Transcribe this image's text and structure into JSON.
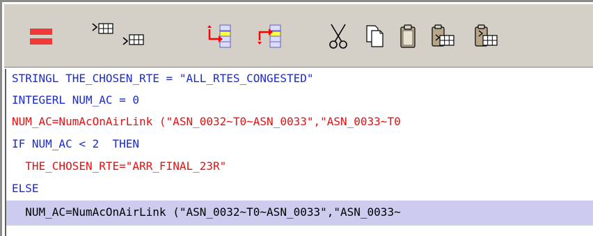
{
  "toolbar": {
    "buttons": [
      {
        "icon": "equals-icon",
        "color": "#f03a3a"
      },
      {
        "icon": "insert-row-above-icon"
      },
      {
        "icon": "insert-row-below-icon"
      },
      {
        "icon": "move-right-icon",
        "color": "#ff0000"
      },
      {
        "icon": "move-left-icon",
        "color": "#ff0000"
      },
      {
        "icon": "cut-icon"
      },
      {
        "icon": "copy-icon"
      },
      {
        "icon": "paste-icon"
      },
      {
        "icon": "paste-before-icon"
      },
      {
        "icon": "paste-after-icon"
      }
    ]
  },
  "code": {
    "lines": [
      {
        "text": "STRINGL THE_CHOSEN_RTE = \"ALL_RTES_CONGESTED\"",
        "color": "#1a2bd0",
        "highlighted": false
      },
      {
        "text": "INTEGERL NUM_AC = 0",
        "color": "#1a2bd0",
        "highlighted": false
      },
      {
        "text": "NUM_AC=NumAcOnAirLink (\"ASN_0032~T0~ASN_0033\",\"ASN_0033~T0",
        "color": "#e81010",
        "highlighted": false
      },
      {
        "text": "IF NUM_AC < 2  THEN",
        "color": "#1a2bd0",
        "highlighted": false
      },
      {
        "text": "  THE_CHOSEN_RTE=\"ARR_FINAL_23R\"",
        "color": "#e81010",
        "highlighted": false
      },
      {
        "text": "ELSE",
        "color": "#1a2bd0",
        "highlighted": false
      },
      {
        "text": "  NUM_AC=NumAcOnAirLink (\"ASN_0032~T0~ASN_0033\",\"ASN_0033~",
        "color": "#000000",
        "highlighted": true
      }
    ]
  }
}
